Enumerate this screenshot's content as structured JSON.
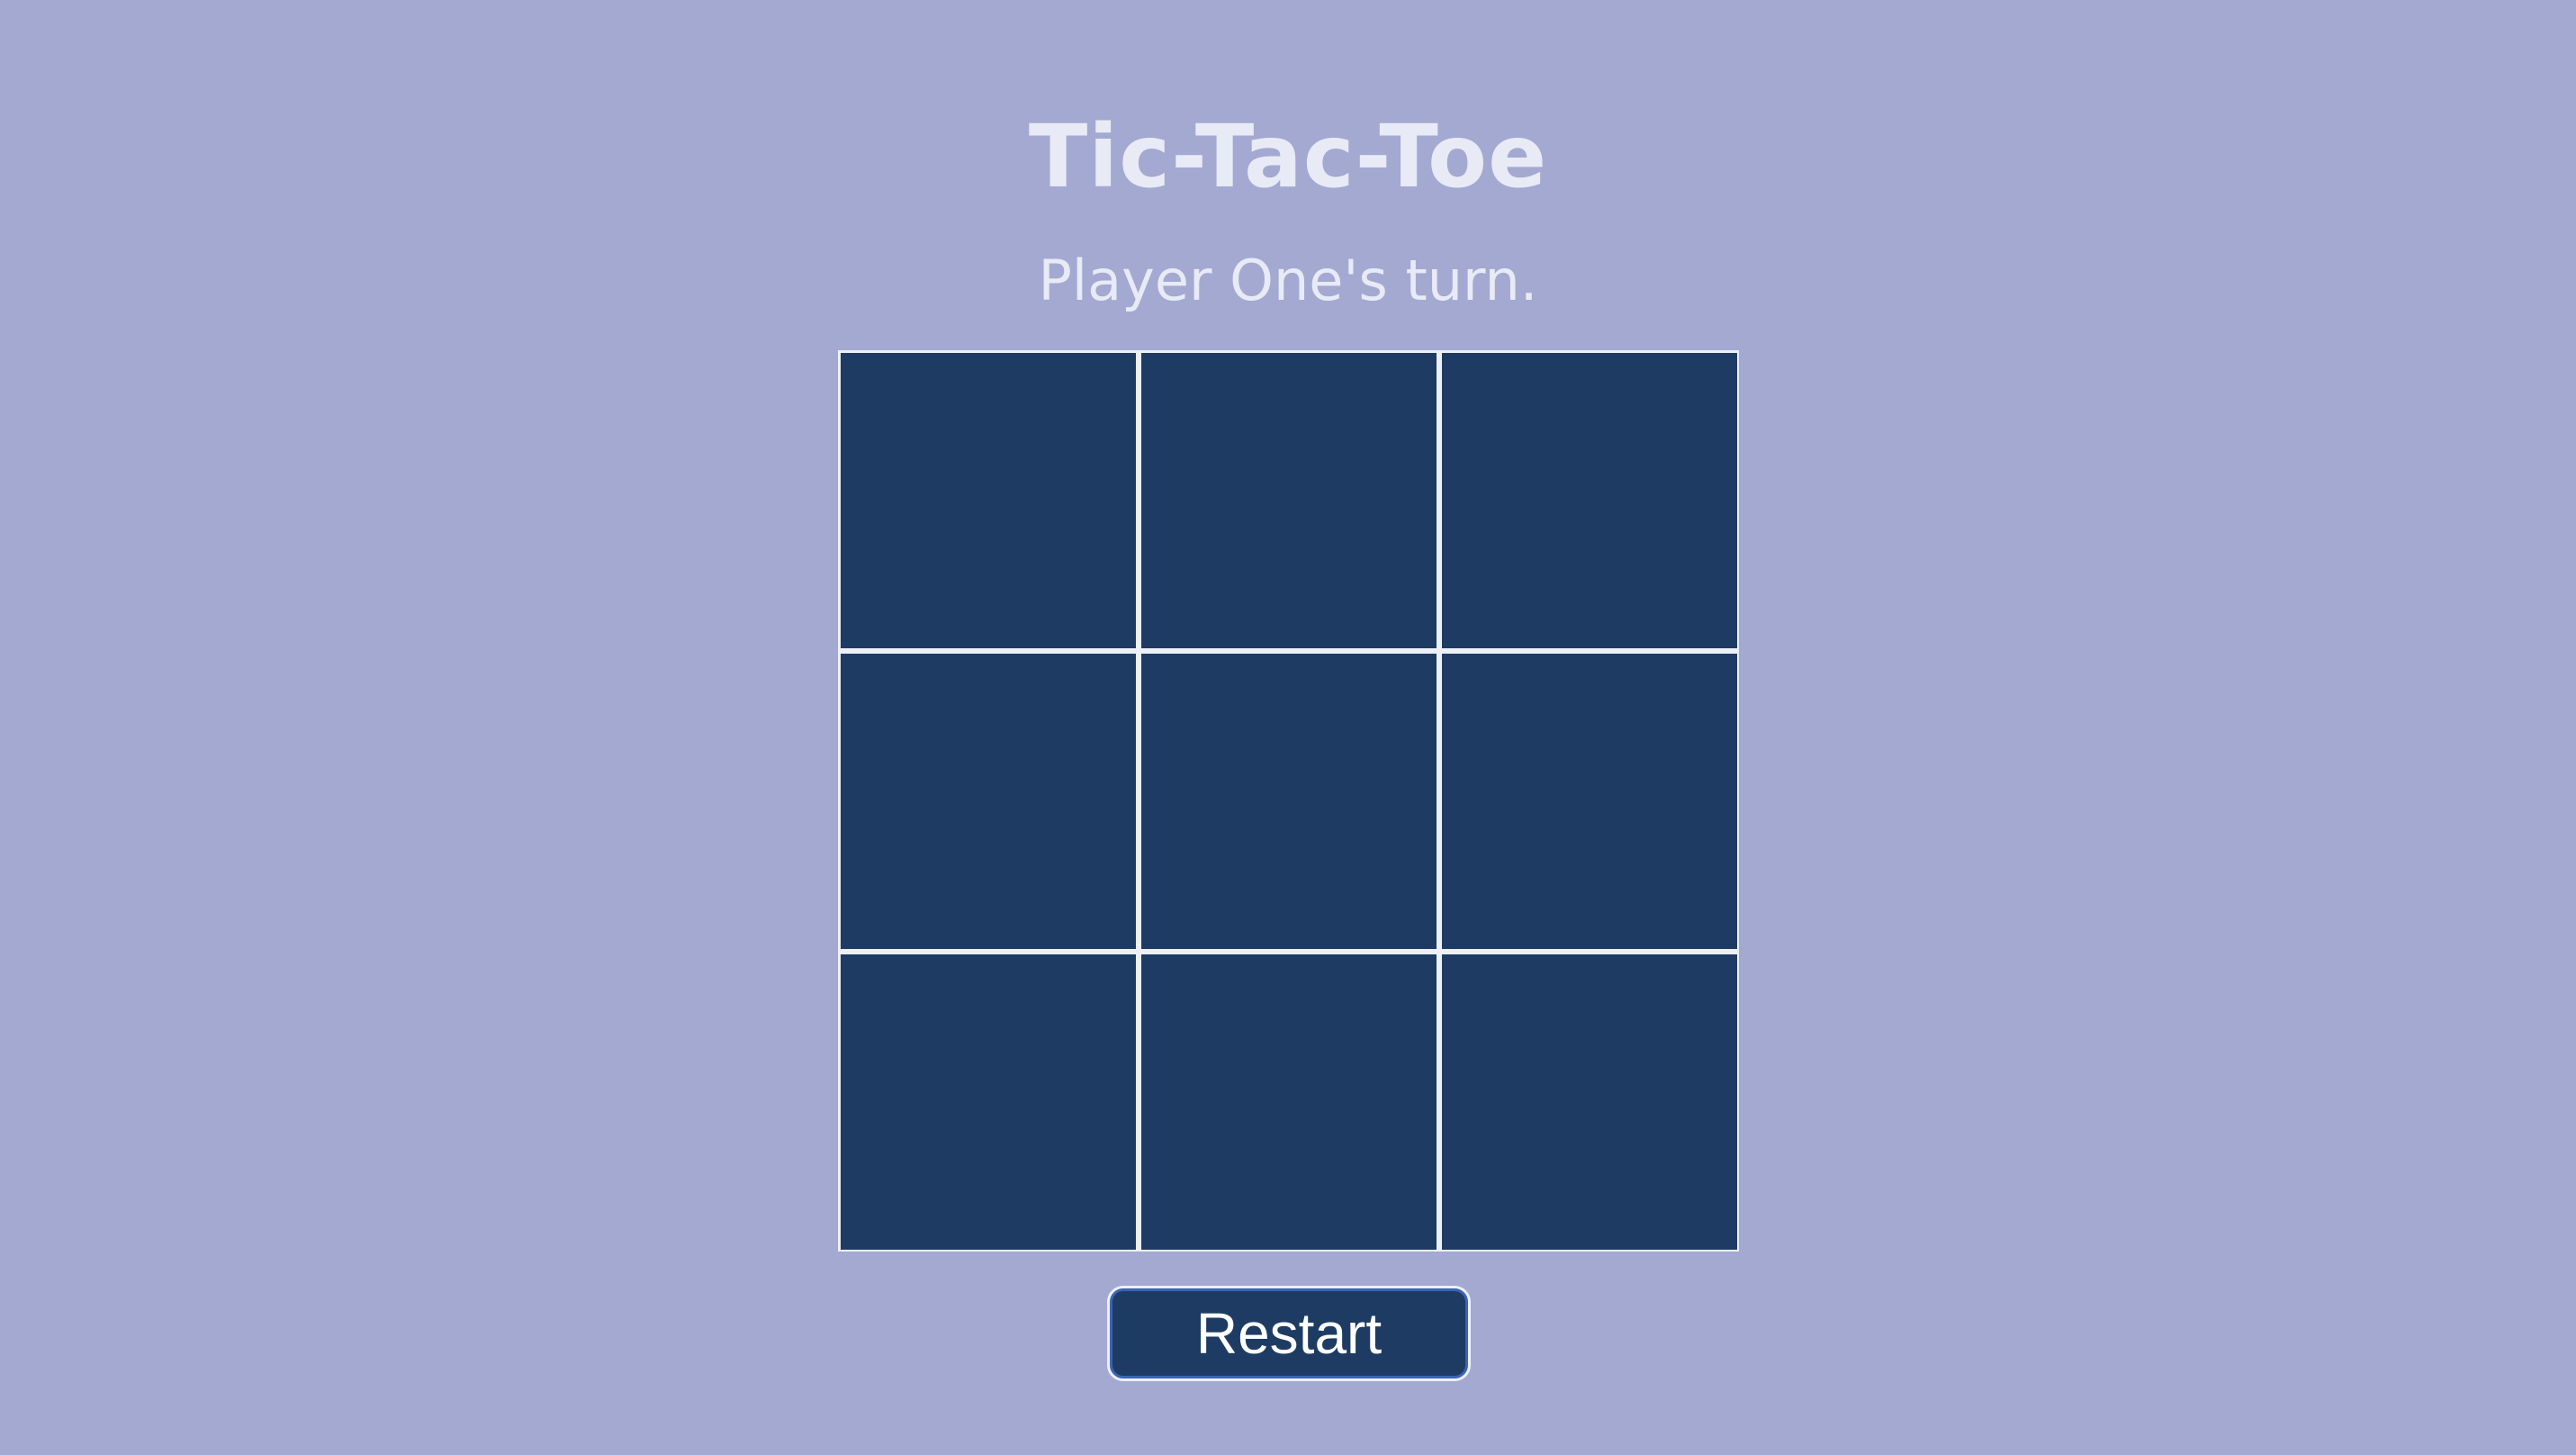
{
  "game": {
    "title": "Tic-Tac-Toe",
    "status": "Player One's turn.",
    "board": [
      [
        "",
        "",
        ""
      ],
      [
        "",
        "",
        ""
      ],
      [
        "",
        "",
        ""
      ]
    ],
    "restart_label": "Restart"
  },
  "colors": {
    "background": "#a3a9d1",
    "cell": "#1e3c63",
    "grid_lines": "#eef0f8",
    "text": "#e8eaf6"
  }
}
